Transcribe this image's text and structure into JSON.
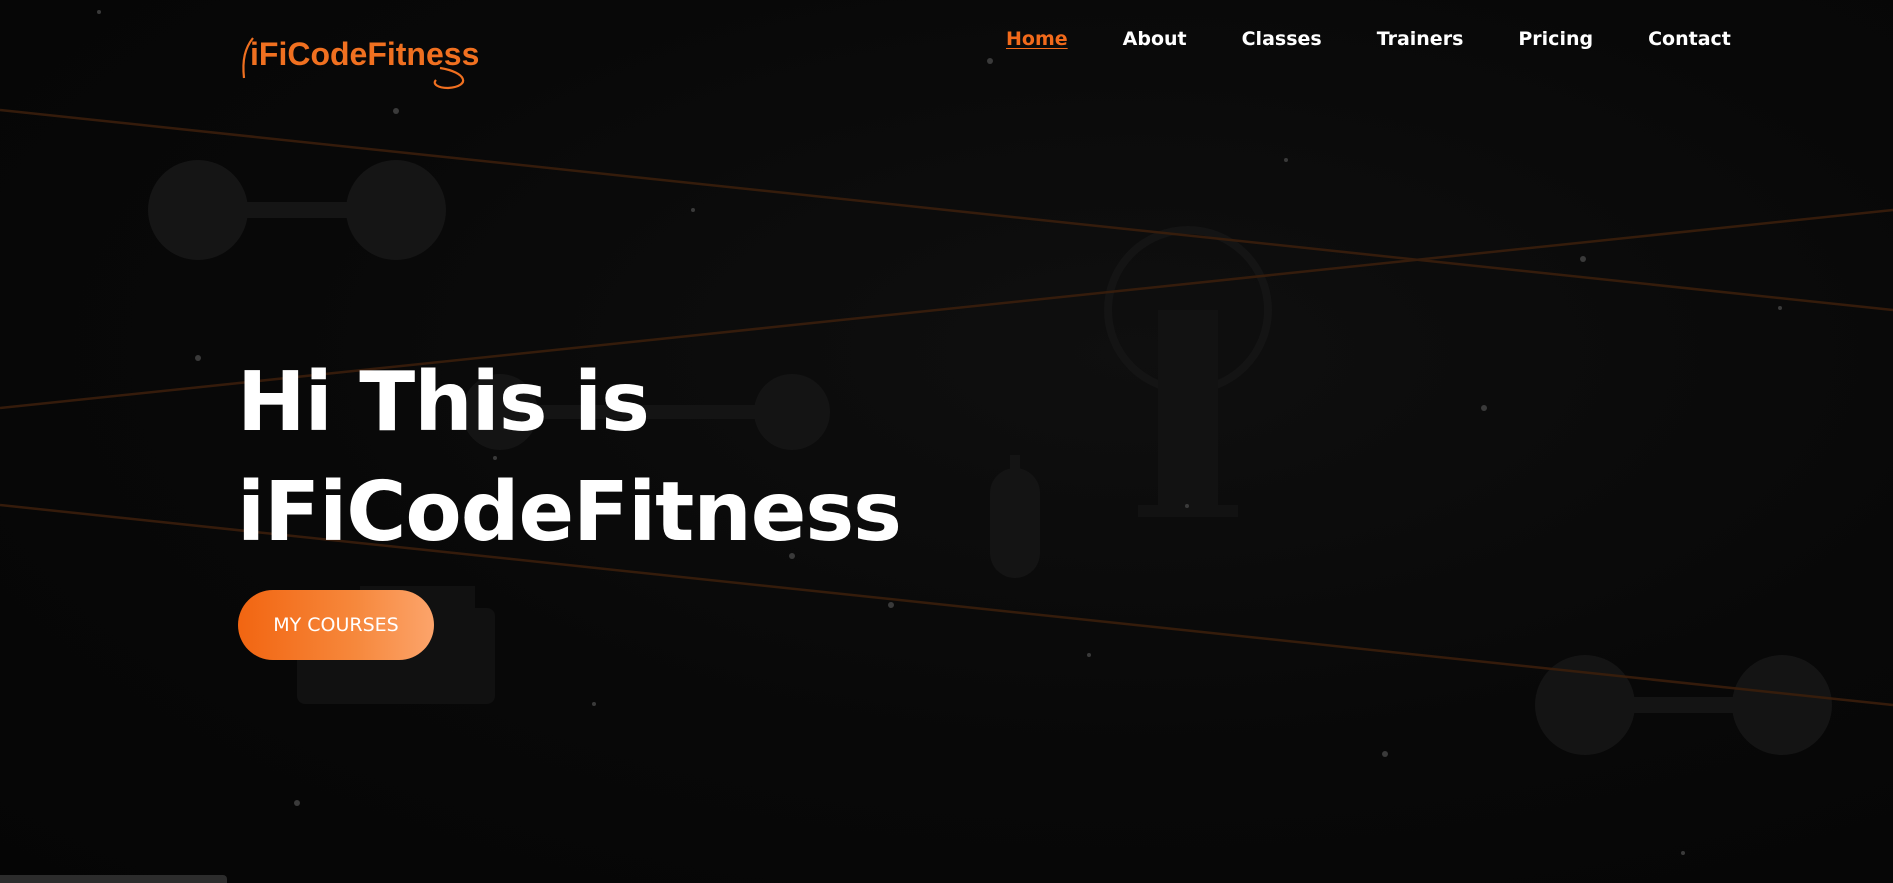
{
  "brand": {
    "logo_text": "iFiCodeFitness",
    "accent_color": "#f26a1b"
  },
  "nav": {
    "items": [
      {
        "label": "Home",
        "active": true
      },
      {
        "label": "About",
        "active": false
      },
      {
        "label": "Classes",
        "active": false
      },
      {
        "label": "Trainers",
        "active": false
      },
      {
        "label": "Pricing",
        "active": false
      },
      {
        "label": "Contact",
        "active": false
      }
    ]
  },
  "hero": {
    "title_line1": "Hi This is",
    "title_line2": "iFiCodeFitness",
    "cta_label": "MY COURSES"
  },
  "background": {
    "decorations": [
      "dumbbell-icon",
      "kettlebell-icon",
      "bottle-icon",
      "laser-lines",
      "particle-dots"
    ]
  }
}
